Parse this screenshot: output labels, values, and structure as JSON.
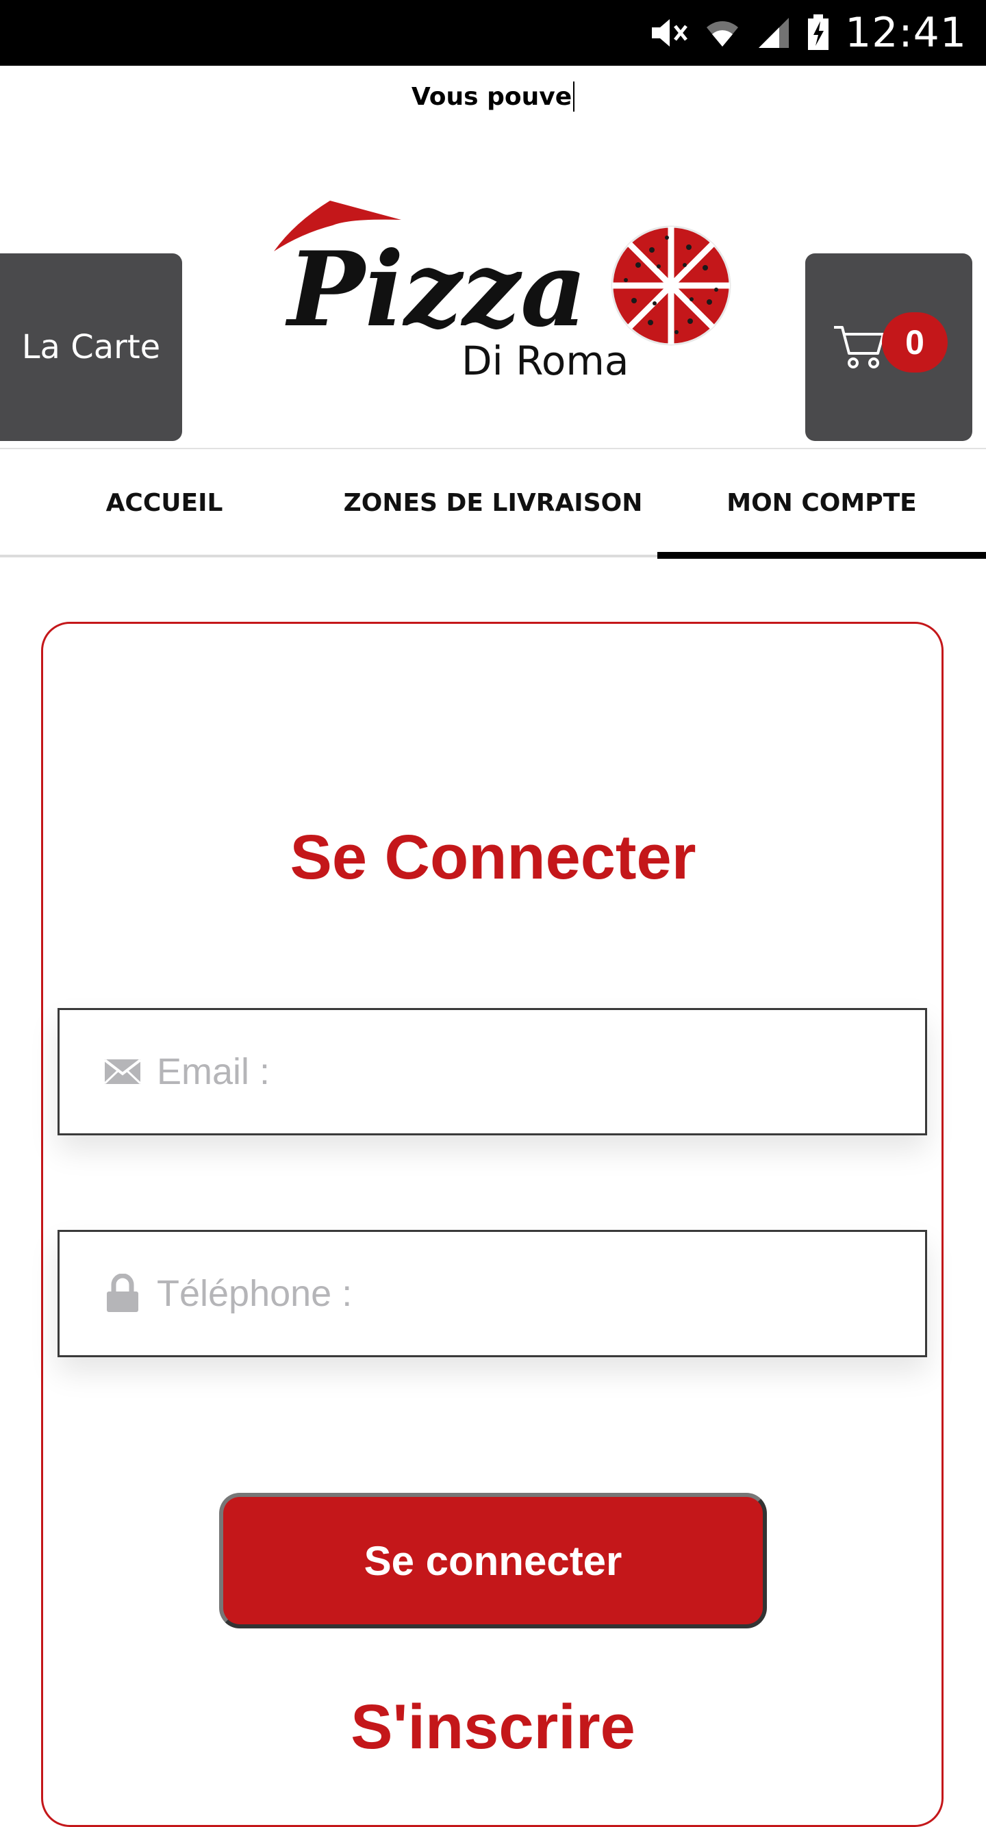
{
  "status_bar": {
    "time": "12:41",
    "icons": [
      "mute-icon",
      "wifi-icon",
      "signal-icon",
      "battery-charging-icon"
    ]
  },
  "ticker": {
    "text": "Vous pouve"
  },
  "header": {
    "menu_button_label": "La Carte",
    "logo": {
      "title": "Pizza",
      "subtitle": "Di Roma"
    },
    "cart": {
      "icon": "cart-icon",
      "count": "0"
    }
  },
  "nav": {
    "items": [
      {
        "label": "ACCUEIL"
      },
      {
        "label": "ZONES DE LIVRAISON"
      },
      {
        "label": "MON COMPTE"
      }
    ],
    "active_index": 2
  },
  "login": {
    "title": "Se Connecter",
    "email": {
      "icon": "envelope-icon",
      "placeholder": "Email :",
      "value": ""
    },
    "phone": {
      "icon": "lock-icon",
      "placeholder": "Téléphone :",
      "value": ""
    },
    "submit_label": "Se connecter"
  },
  "signup": {
    "title": "S'inscrire"
  },
  "colors": {
    "accent": "#c4171a",
    "button_dark": "#4a4a4c",
    "status_bar": "#000000"
  }
}
